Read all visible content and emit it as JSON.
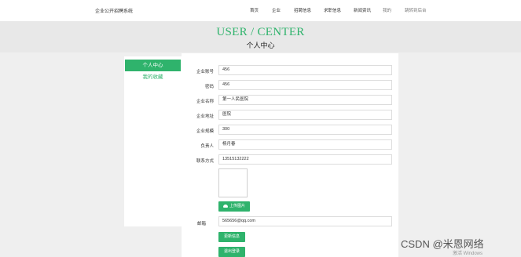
{
  "header": {
    "site_name": "企业公开招聘系统",
    "nav": [
      "首页",
      "企业",
      "招聘信息",
      "求职信息",
      "新闻资讯",
      "我的",
      "跳转到后台"
    ]
  },
  "banner": {
    "title": "USER / CENTER",
    "subtitle": "个人中心"
  },
  "sidebar": {
    "items": [
      {
        "label": "个人中心"
      },
      {
        "label": "我的收藏"
      }
    ]
  },
  "form": {
    "fields": [
      {
        "label": "企业账号",
        "value": "456"
      },
      {
        "label": "密码",
        "value": "456"
      },
      {
        "label": "企业名称",
        "value": "第一人民医院"
      },
      {
        "label": "企业地址",
        "value": "医院"
      },
      {
        "label": "企业规模",
        "value": "300"
      },
      {
        "label": "负责人",
        "value": "杨月春"
      },
      {
        "label": "联系方式",
        "value": "13515132222"
      }
    ],
    "upload_label": "上传图片",
    "email_label": "邮箱",
    "email_value": "565656@qq.com",
    "update_label": "更新信息",
    "logout_label": "退出登录"
  },
  "watermark": {
    "text": "CSDN @米恩网络",
    "activate": "激活 Windows"
  },
  "colors": {
    "accent": "#2fb36c"
  },
  "icons": {
    "upload": "cloud-upload-icon"
  }
}
